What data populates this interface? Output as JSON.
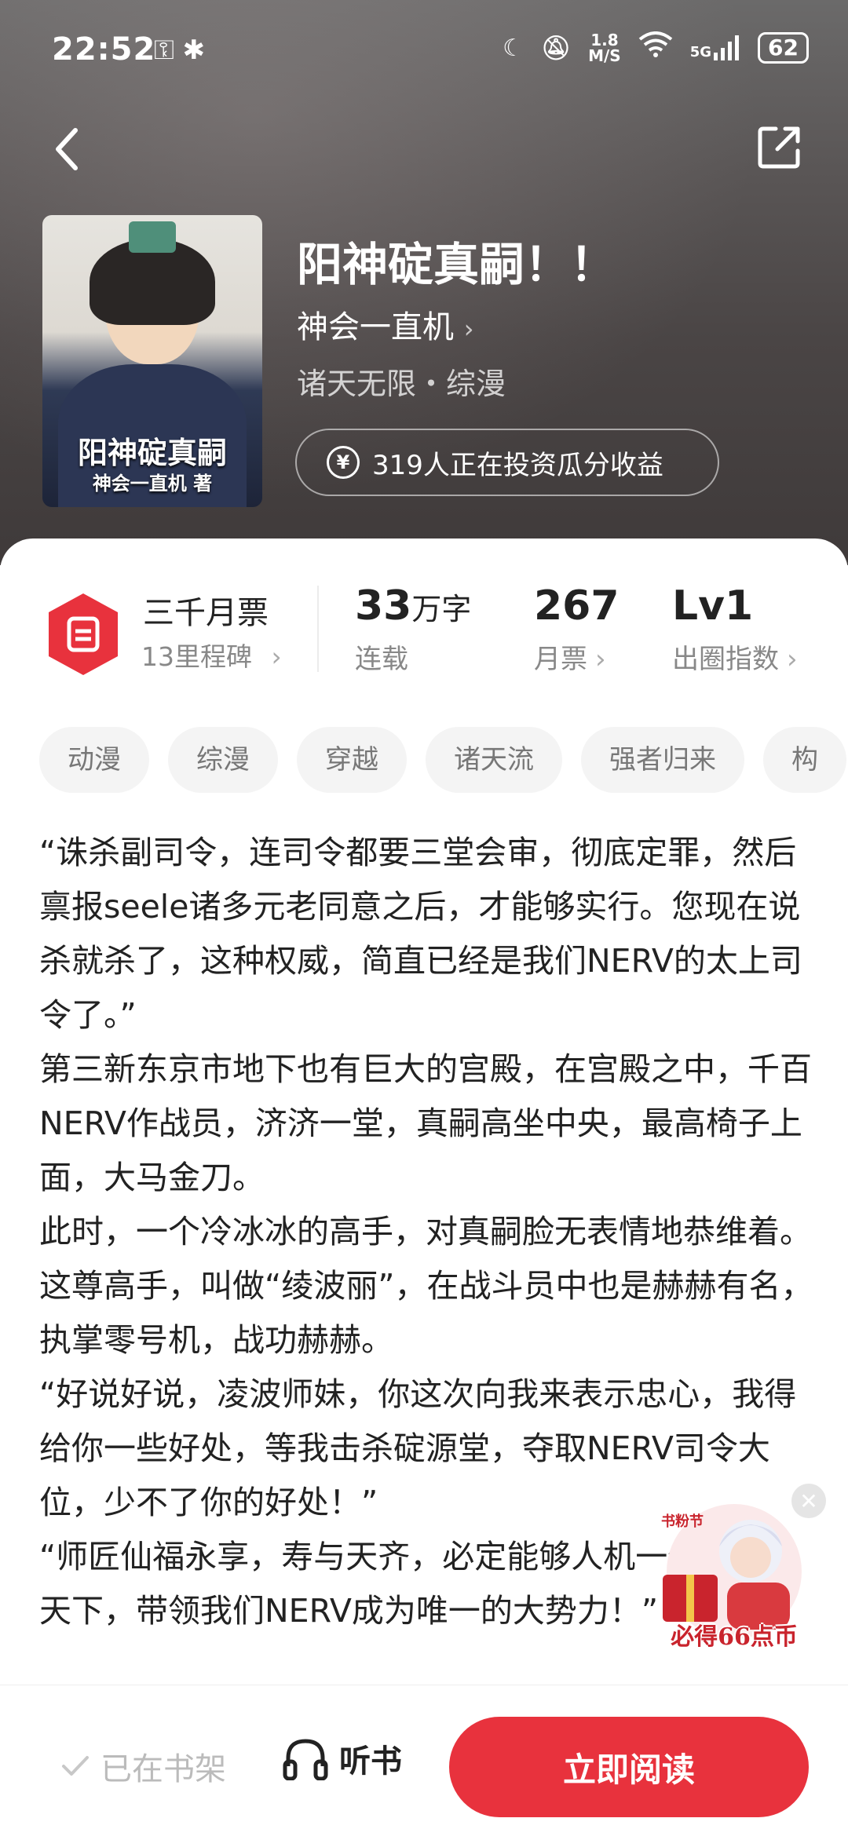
{
  "status_bar": {
    "time": "22:52",
    "net_speed_top": "1.8",
    "net_speed_bottom": "M/S",
    "signal": "5G",
    "battery": "62"
  },
  "book": {
    "title": "阳神碇真嗣！！",
    "author": "神会一直机",
    "category": "诸天无限・综漫",
    "cover_title": "阳神碇真嗣",
    "cover_author": "神会一直机 著",
    "invest_text": "319人正在投资瓜分收益"
  },
  "stats": {
    "rank_title": "三千月票",
    "rank_sub": "13里程碑",
    "words_num": "33",
    "words_unit": "万字",
    "words_label": "连载",
    "tickets_num": "267",
    "tickets_label": "月票",
    "level_num": "Lv1",
    "level_label": "出圈指数"
  },
  "tags": [
    "动漫",
    "综漫",
    "穿越",
    "诸天流",
    "强者归来",
    "构"
  ],
  "article": [
    "“诛杀副司令，连司令都要三堂会审，彻底定罪，然后禀报seele诸多元老同意之后，才能够实行。您现在说杀就杀了，这种权威，简直已经是我们NERV的太上司令了。”",
    "第三新东京市地下也有巨大的宫殿，在宫殿之中，千百NERV作战员，济济一堂，真嗣高坐中央，最高椅子上面，大马金刀。",
    "此时，一个冷冰冰的高手，对真嗣脸无表情地恭维着。这尊高手，叫做“绫波丽”，在战斗员中也是赫赫有名，执掌零号机，战功赫赫。",
    "“好说好说，凌波师妹，你这次向我来表示忠心，我得给你一些好处，等我击杀碇源堂，夺取NERV司令大位，少不了你的好处！”",
    "“师匠仙福永享，寿与天齐，必定能够人机一体，一统天下，带领我们NERV成为唯一的大势力！”"
  ],
  "promo": {
    "top_text": "书粉节",
    "bottom_text": "必得66点币"
  },
  "bottom_bar": {
    "shelf_label": "已在书架",
    "listen_label": "听书",
    "read_label": "立即阅读"
  },
  "colors": {
    "accent": "#e8323d",
    "hero_bg": "#4a4545"
  }
}
